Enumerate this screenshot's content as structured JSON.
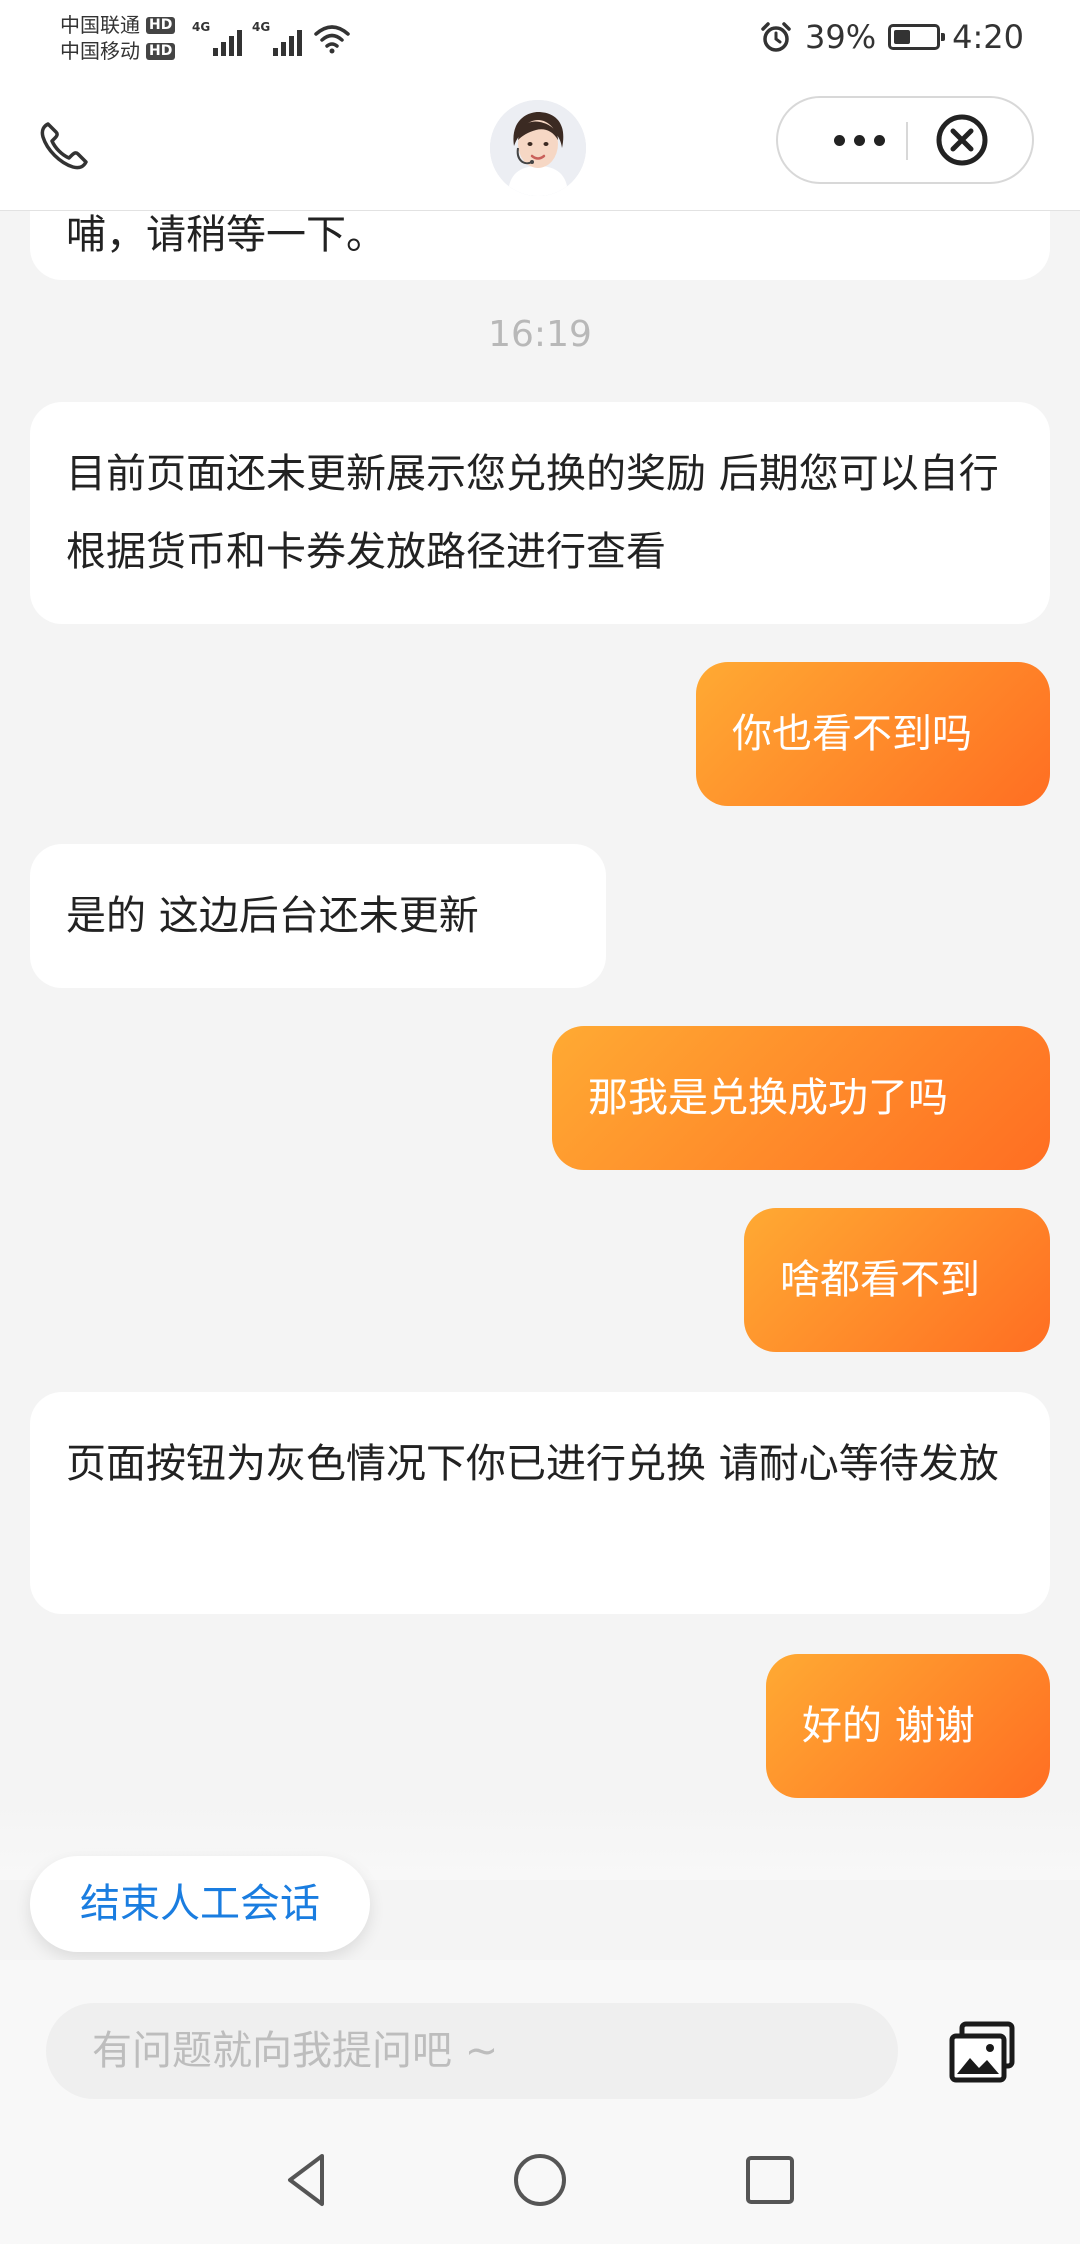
{
  "status_bar": {
    "carriers": [
      {
        "name": "中国联通",
        "badge": "HD"
      },
      {
        "name": "中国移动",
        "badge": "HD"
      }
    ],
    "network_labels": [
      "4G",
      "4G"
    ],
    "battery_percent": "39%",
    "battery_level": 0.39,
    "time": "4:20"
  },
  "header": {
    "phone_icon": "phone-icon",
    "avatar": "agent-avatar",
    "more_icon": "more-dots-icon",
    "close_icon": "close-circle-icon"
  },
  "chat": {
    "partial_top_message": "哺，请稍等一下。",
    "timestamp": "16:19",
    "messages": [
      {
        "side": "left",
        "text": "目前页面还未更新展示您兑换的奖励  后期您可以自行根据货币和卡券发放路径进行查看"
      },
      {
        "side": "right",
        "text": "你也看不到吗"
      },
      {
        "side": "left",
        "text": "是的  这边后台还未更新"
      },
      {
        "side": "right",
        "text": "那我是兑换成功了吗"
      },
      {
        "side": "right",
        "text": "啥都看不到"
      },
      {
        "side": "left",
        "text": "页面按钮为灰色情况下你已进行兑换  请耐心等待发放"
      },
      {
        "side": "right",
        "text": "好的  谢谢"
      }
    ]
  },
  "end_session_label": "结束人工会话",
  "input": {
    "placeholder": "有问题就向我提问吧 ~",
    "value": ""
  },
  "image_icon": "image-gallery-icon",
  "nav": [
    "back-icon",
    "home-icon",
    "recents-icon"
  ],
  "colors": {
    "accent_start": "#ffaa33",
    "accent_end": "#ff6e22",
    "link_blue": "#1a7de0",
    "background": "#f4f4f4"
  }
}
